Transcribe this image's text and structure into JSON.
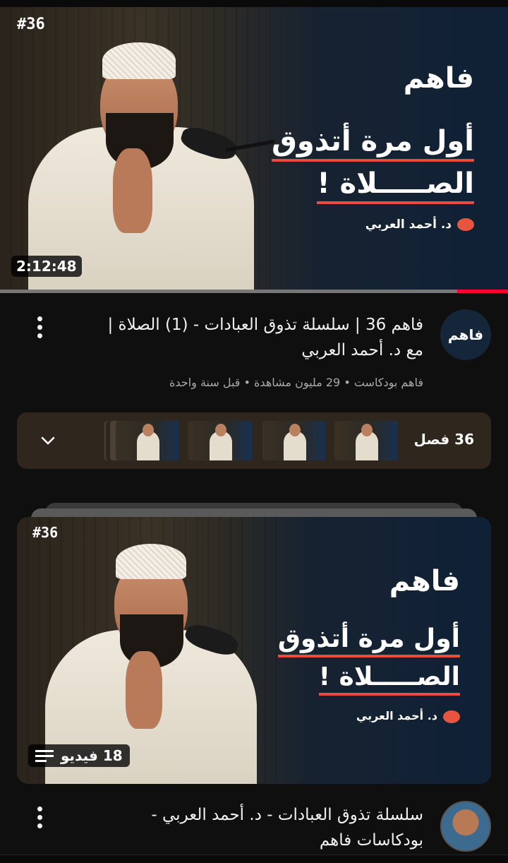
{
  "video": {
    "episode_badge": "#36",
    "duration": "2:12:48",
    "watch_progress_fraction": 0.1,
    "thumbnail": {
      "brand": "فاهم",
      "headline_line1": "أول مرة أتذوق",
      "headline_line2": "الصـــــلاة !",
      "speaker": "د. أحمد العربي"
    },
    "channel_avatar_text": "فاهم",
    "title": "فاهم 36 | سلسلة تذوق العبادات - (1) الصلاة | مع د. أحمد العربي",
    "meta": "فاهم بودكاست • 29 مليون مشاهدة • قبل سنة واحدة",
    "more_icon": "more-vert-icon"
  },
  "chapters": {
    "label": "36 فصل",
    "expand_icon": "chevron-down-icon",
    "thumbnails_count_visible": 4
  },
  "playlist": {
    "episode_badge": "#36",
    "thumbnail": {
      "brand": "فاهم",
      "headline_line1": "أول مرة أتذوق",
      "headline_line2": "الصـــــلاة !",
      "speaker": "د. أحمد العربي"
    },
    "video_count": "18 فيديو",
    "title": "سلسلة تذوق العبادات - د. أحمد العربي - بودكاسات فاهم",
    "more_icon": "more-vert-icon"
  },
  "colors": {
    "background": "#0f0f0f",
    "accent_red": "#ff0033",
    "chapters_bg": "#2f271d",
    "channel_avatar_bg": "#15263b"
  }
}
